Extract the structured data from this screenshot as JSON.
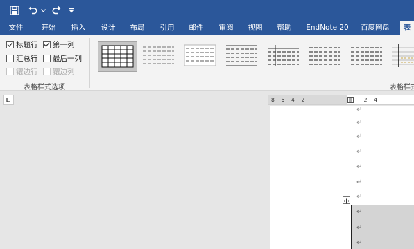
{
  "quick_access": {
    "icons": [
      "save-icon",
      "undo-icon",
      "redo-icon",
      "customize-qat-icon"
    ]
  },
  "tabs": [
    {
      "label": "文件",
      "active": false
    },
    {
      "label": "开始",
      "active": false
    },
    {
      "label": "插入",
      "active": false
    },
    {
      "label": "设计",
      "active": false
    },
    {
      "label": "布局",
      "active": false
    },
    {
      "label": "引用",
      "active": false
    },
    {
      "label": "邮件",
      "active": false
    },
    {
      "label": "审阅",
      "active": false
    },
    {
      "label": "视图",
      "active": false
    },
    {
      "label": "帮助",
      "active": false
    },
    {
      "label": "EndNote 20",
      "active": false
    },
    {
      "label": "百度网盘",
      "active": false
    },
    {
      "label": "表",
      "active": true
    }
  ],
  "table_style_options": {
    "group_label": "表格样式选项",
    "options": [
      {
        "label": "标题行",
        "checked": true,
        "disabled": false
      },
      {
        "label": "第一列",
        "checked": true,
        "disabled": false
      },
      {
        "label": "汇总行",
        "checked": false,
        "disabled": false
      },
      {
        "label": "最后一列",
        "checked": false,
        "disabled": false
      },
      {
        "label": "镶边行",
        "checked": false,
        "disabled": true
      },
      {
        "label": "镶边列",
        "checked": false,
        "disabled": true
      }
    ]
  },
  "table_styles": {
    "group_label": "表格样式",
    "selected_index": 0,
    "count": 8
  },
  "ruler": {
    "left_text": "8  6  4  2",
    "right_text": "  2  4"
  },
  "document": {
    "paragraph_mark": "↵"
  },
  "colors": {
    "accent": "#2b579a",
    "ribbon": "#f3f3f3",
    "workspace": "#e6e6e6",
    "table_shading": "#d4d4d4"
  }
}
